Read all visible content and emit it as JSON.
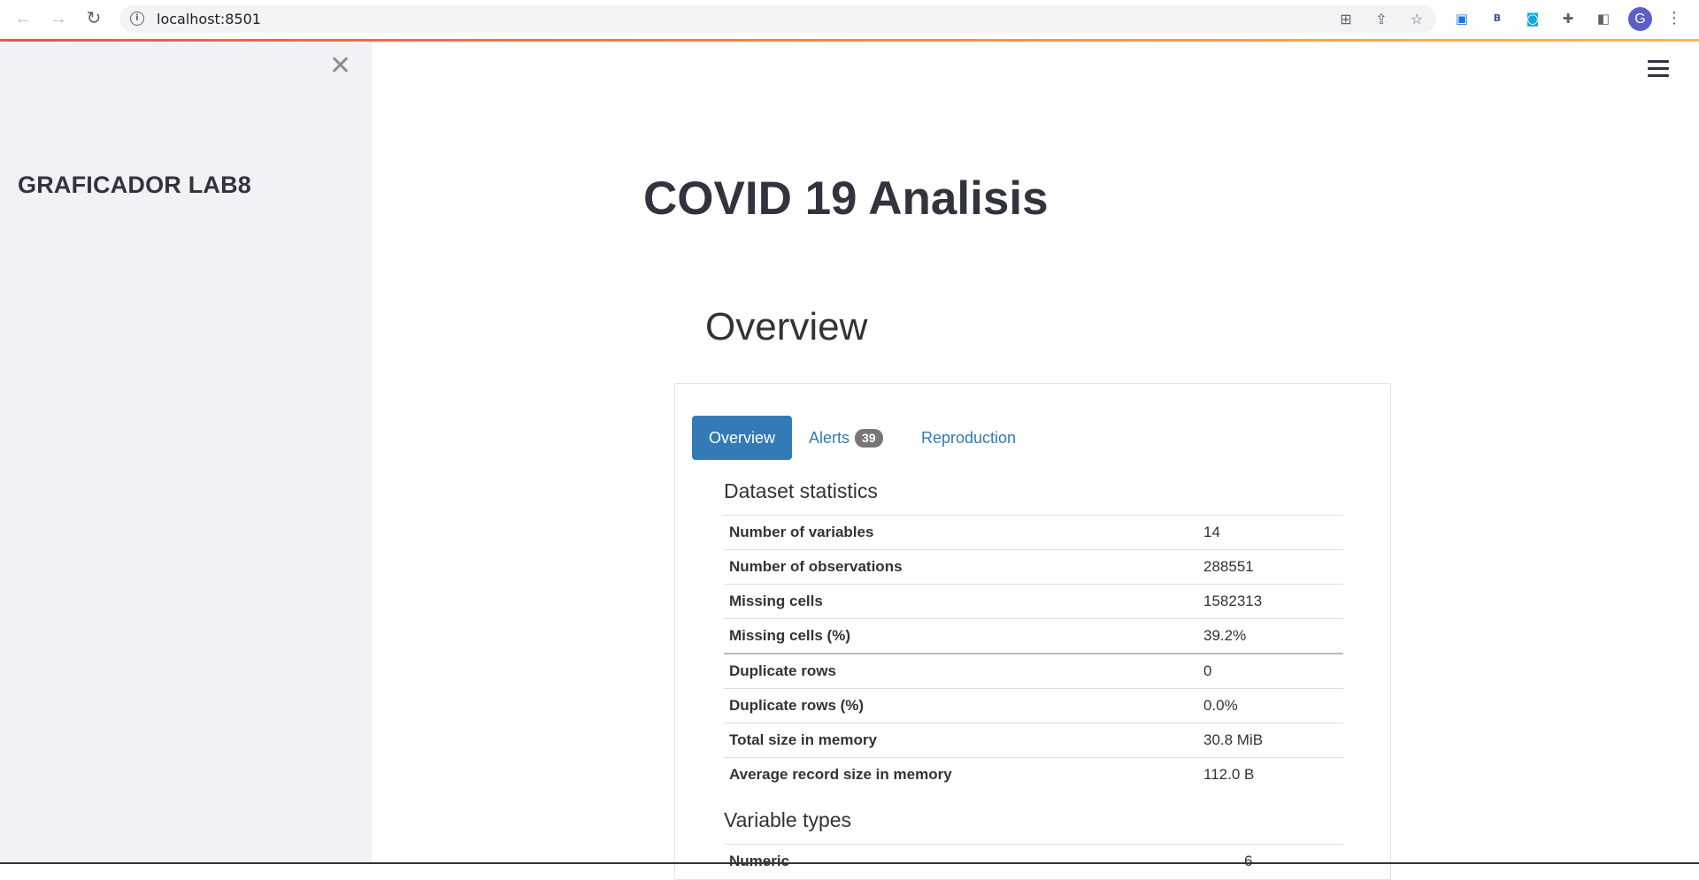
{
  "browser": {
    "url": "localhost:8501",
    "avatar_letter": "G"
  },
  "sidebar": {
    "title": "GRAFICADOR LAB8",
    "close_glyph": "✕"
  },
  "main": {
    "title": "COVID 19 Analisis",
    "section_heading": "Overview"
  },
  "report": {
    "tabs": [
      {
        "label": "Overview",
        "active": true
      },
      {
        "label": "Alerts",
        "badge": "39"
      },
      {
        "label": "Reproduction"
      }
    ],
    "dataset_statistics": {
      "title": "Dataset statistics",
      "rows": [
        {
          "label": "Number of variables",
          "value": "14"
        },
        {
          "label": "Number of observations",
          "value": "288551"
        },
        {
          "label": "Missing cells",
          "value": "1582313"
        },
        {
          "label": "Missing cells (%)",
          "value": "39.2%"
        },
        {
          "label": "Duplicate rows",
          "value": "0"
        },
        {
          "label": "Duplicate rows (%)",
          "value": "0.0%"
        },
        {
          "label": "Total size in memory",
          "value": "30.8 MiB"
        },
        {
          "label": "Average record size in memory",
          "value": "112.0 B"
        }
      ]
    },
    "variable_types": {
      "title": "Variable types",
      "rows": [
        {
          "label": "Numeric",
          "value": "6"
        }
      ]
    }
  },
  "colors": {
    "accent": "#337ab7",
    "sidebar_bg": "#f0f2f6",
    "decoration_start": "#ff4b4b",
    "decoration_end": "#ffbd45"
  },
  "icons": [
    "back-arrow-icon",
    "forward-arrow-icon",
    "reload-icon",
    "info-icon",
    "translate-icon",
    "share-icon",
    "star-icon",
    "extension-icon",
    "puzzle-icon",
    "side-panel-icon",
    "kebab-menu-icon",
    "close-icon",
    "hamburger-menu-icon"
  ]
}
